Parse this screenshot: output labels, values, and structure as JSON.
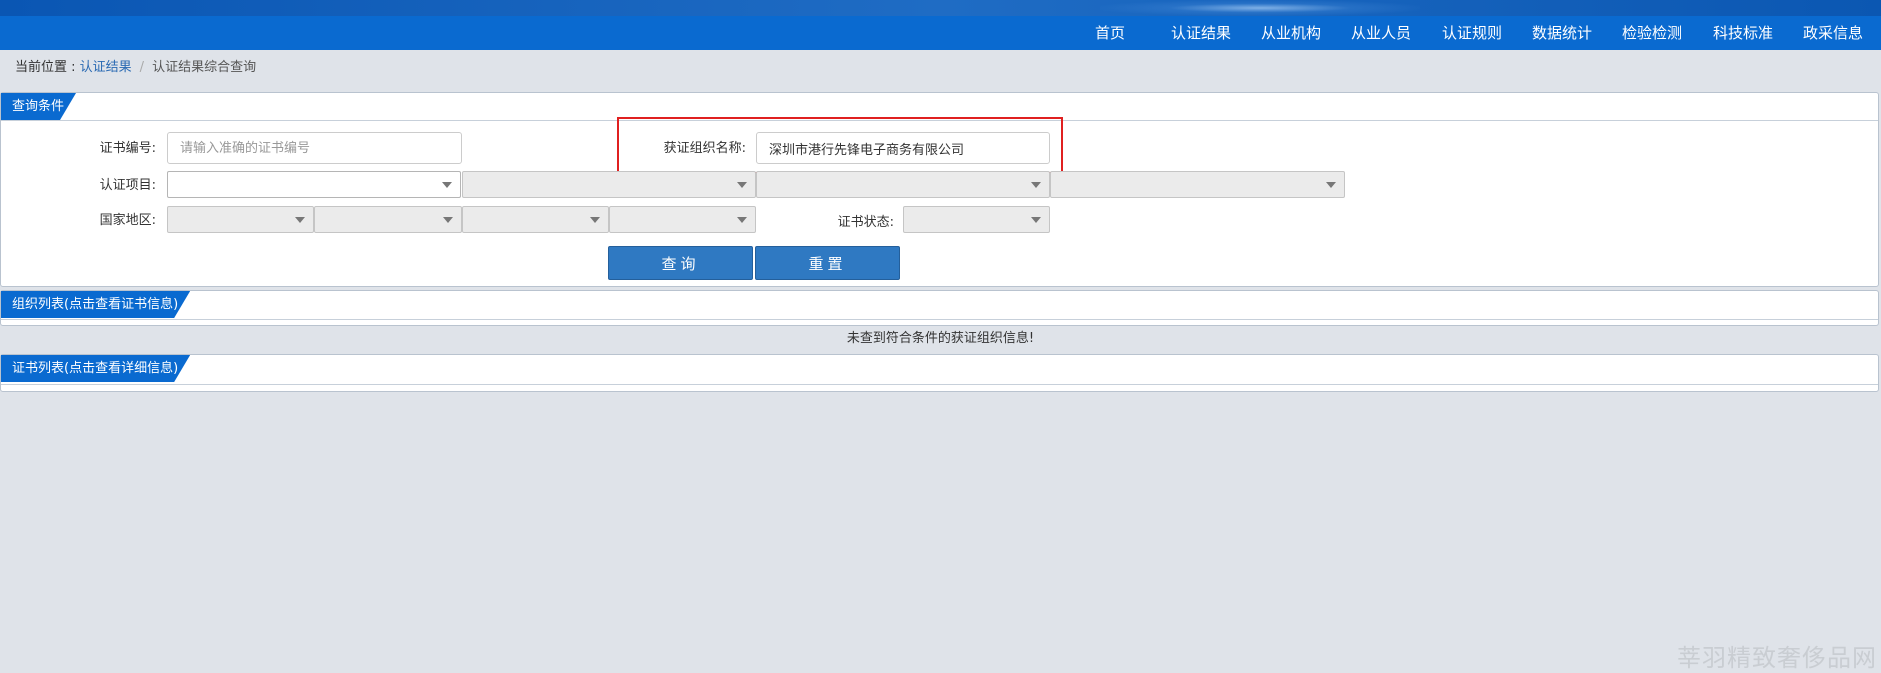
{
  "nav": {
    "items": [
      {
        "label": "首页"
      },
      {
        "label": "认证结果"
      },
      {
        "label": "从业机构"
      },
      {
        "label": "从业人员"
      },
      {
        "label": "认证规则"
      },
      {
        "label": "数据统计"
      },
      {
        "label": "检验检测"
      },
      {
        "label": "科技标准"
      },
      {
        "label": "政采信息"
      }
    ]
  },
  "breadcrumb": {
    "prefix": "当前位置 : ",
    "link": "认证结果",
    "separator": "/",
    "current": "认证结果综合查询"
  },
  "query": {
    "tab_label": "查询条件",
    "cert_no_label": "证书编号:",
    "cert_no_placeholder": "请输入准确的证书编号",
    "org_name_label": "获证组织名称:",
    "org_name_value": "深圳市港行先锋电子商务有限公司",
    "cert_item_label": "认证项目:",
    "region_label": "国家地区:",
    "cert_status_label": "证书状态:",
    "search_button": "查询",
    "reset_button": "重置"
  },
  "org_list": {
    "tab_label": "组织列表(点击查看证书信息)",
    "empty_message": "未查到符合条件的获证组织信息!"
  },
  "cert_list": {
    "tab_label": "证书列表(点击查看详细信息)"
  },
  "watermark": "莘羽精致奢侈品网",
  "colors": {
    "nav_bg": "#0a6ad0",
    "tab_bg": "#0a6ad0",
    "button_bg": "#2f79c2",
    "highlight_border": "#e02020",
    "page_bg": "#dfe3e9"
  }
}
